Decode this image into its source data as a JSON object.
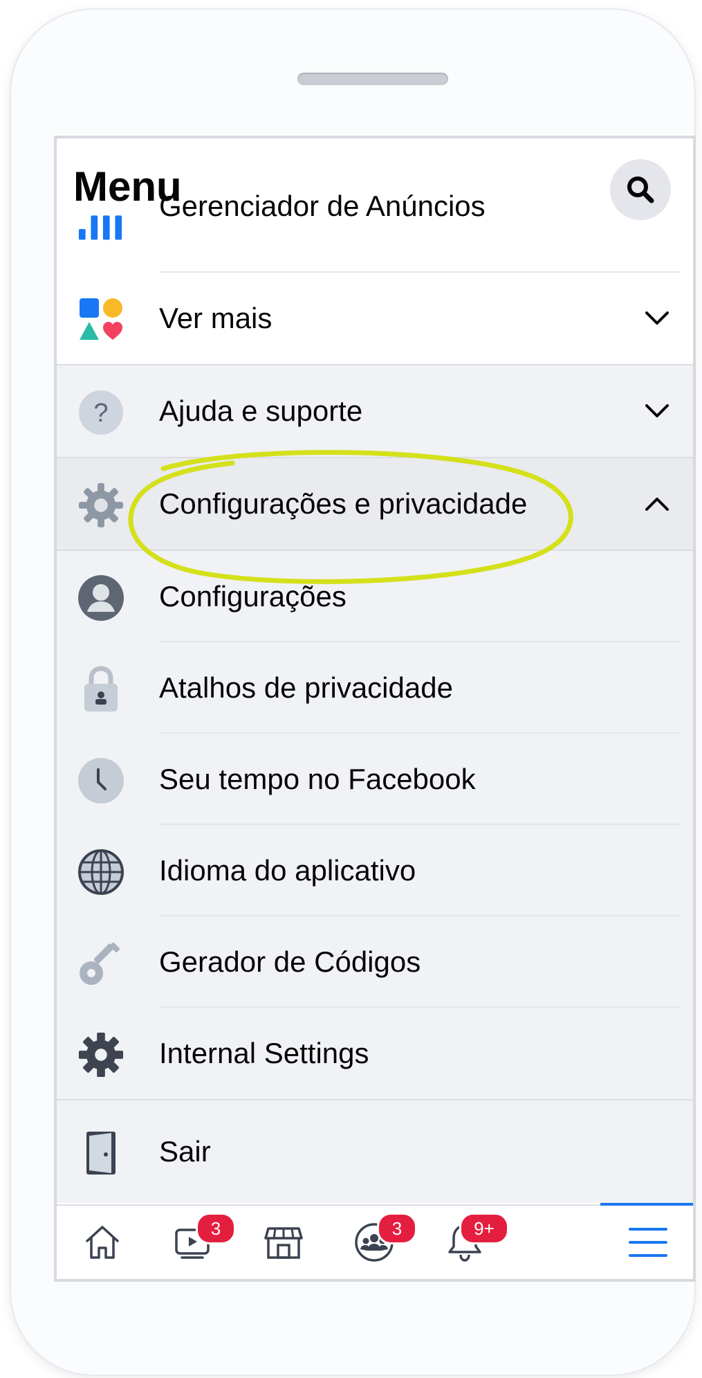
{
  "header": {
    "title": "Menu"
  },
  "rows": {
    "ads_manager": "Gerenciador de Anúncios",
    "see_more": "Ver mais",
    "help": "Ajuda e suporte",
    "settings_privacy": "Configurações e privacidade",
    "settings": "Configurações",
    "privacy_shortcuts": "Atalhos de privacidade",
    "your_time": "Seu tempo no Facebook",
    "app_language": "Idioma do aplicativo",
    "code_generator": "Gerador de Códigos",
    "internal_settings": "Internal Settings",
    "logout": "Sair"
  },
  "tabbar": {
    "watch_badge": "3",
    "groups_badge": "3",
    "notifications_badge": "9+"
  },
  "colors": {
    "accent": "#1877f2",
    "badge": "#e41e3f",
    "highlight": "#d4e01a"
  },
  "icons": [
    "search-icon",
    "ads-manager-icon",
    "see-more-icon",
    "help-icon",
    "gear-icon",
    "account-icon",
    "lock-icon",
    "clock-icon",
    "globe-icon",
    "key-icon",
    "settings-gear-icon",
    "door-icon",
    "chevron-down-icon",
    "chevron-up-icon",
    "home-icon",
    "watch-icon",
    "marketplace-icon",
    "groups-icon",
    "bell-icon",
    "hamburger-icon"
  ]
}
